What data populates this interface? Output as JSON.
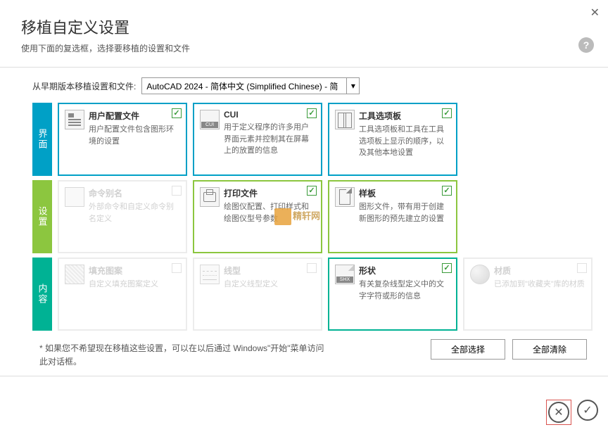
{
  "dialog": {
    "title": "移植自定义设置",
    "subtitle": "使用下面的复选框，选择要移植的设置和文件"
  },
  "version": {
    "label": "从早期版本移植设置和文件:",
    "selected": "AutoCAD 2024 - 简体中文 (Simplified Chinese) - 简"
  },
  "sections": {
    "interface": "界面",
    "settings": "设置",
    "content": "内容"
  },
  "cards": {
    "profile": {
      "title": "用户配置文件",
      "desc": "用户配置文件包含图形环境的设置"
    },
    "cui": {
      "title": "CUI",
      "desc": "用于定义程序的许多用户界面元素并控制其在屏幕上的放置的信息"
    },
    "palette": {
      "title": "工具选项板",
      "desc": "工具选项板和工具在工具选项板上显示的顺序，以及其他本地设置"
    },
    "alias": {
      "title": "命令别名",
      "desc": "外部命令和自定义命令别名定义"
    },
    "print": {
      "title": "打印文件",
      "desc": "绘图仪配置、打印样式和绘图仪型号参数"
    },
    "template": {
      "title": "样板",
      "desc": "图形文件，带有用于创建新图形的预先建立的设置"
    },
    "hatch": {
      "title": "填充图案",
      "desc": "自定义填充图案定义"
    },
    "linetype": {
      "title": "线型",
      "desc": "自定义线型定义"
    },
    "shape": {
      "title": "形状",
      "desc": "有关复杂线型定义中的文字字符或形的信息"
    },
    "material": {
      "title": "材质",
      "desc": "已添加到\"收藏夹\"库的材质"
    }
  },
  "footer": {
    "note": "* 如果您不希望现在移植这些设置，可以在以后通过 Windows\"开始\"菜单访问此对话框。",
    "select_all": "全部选择",
    "clear_all": "全部清除"
  },
  "watermark": "精轩网"
}
